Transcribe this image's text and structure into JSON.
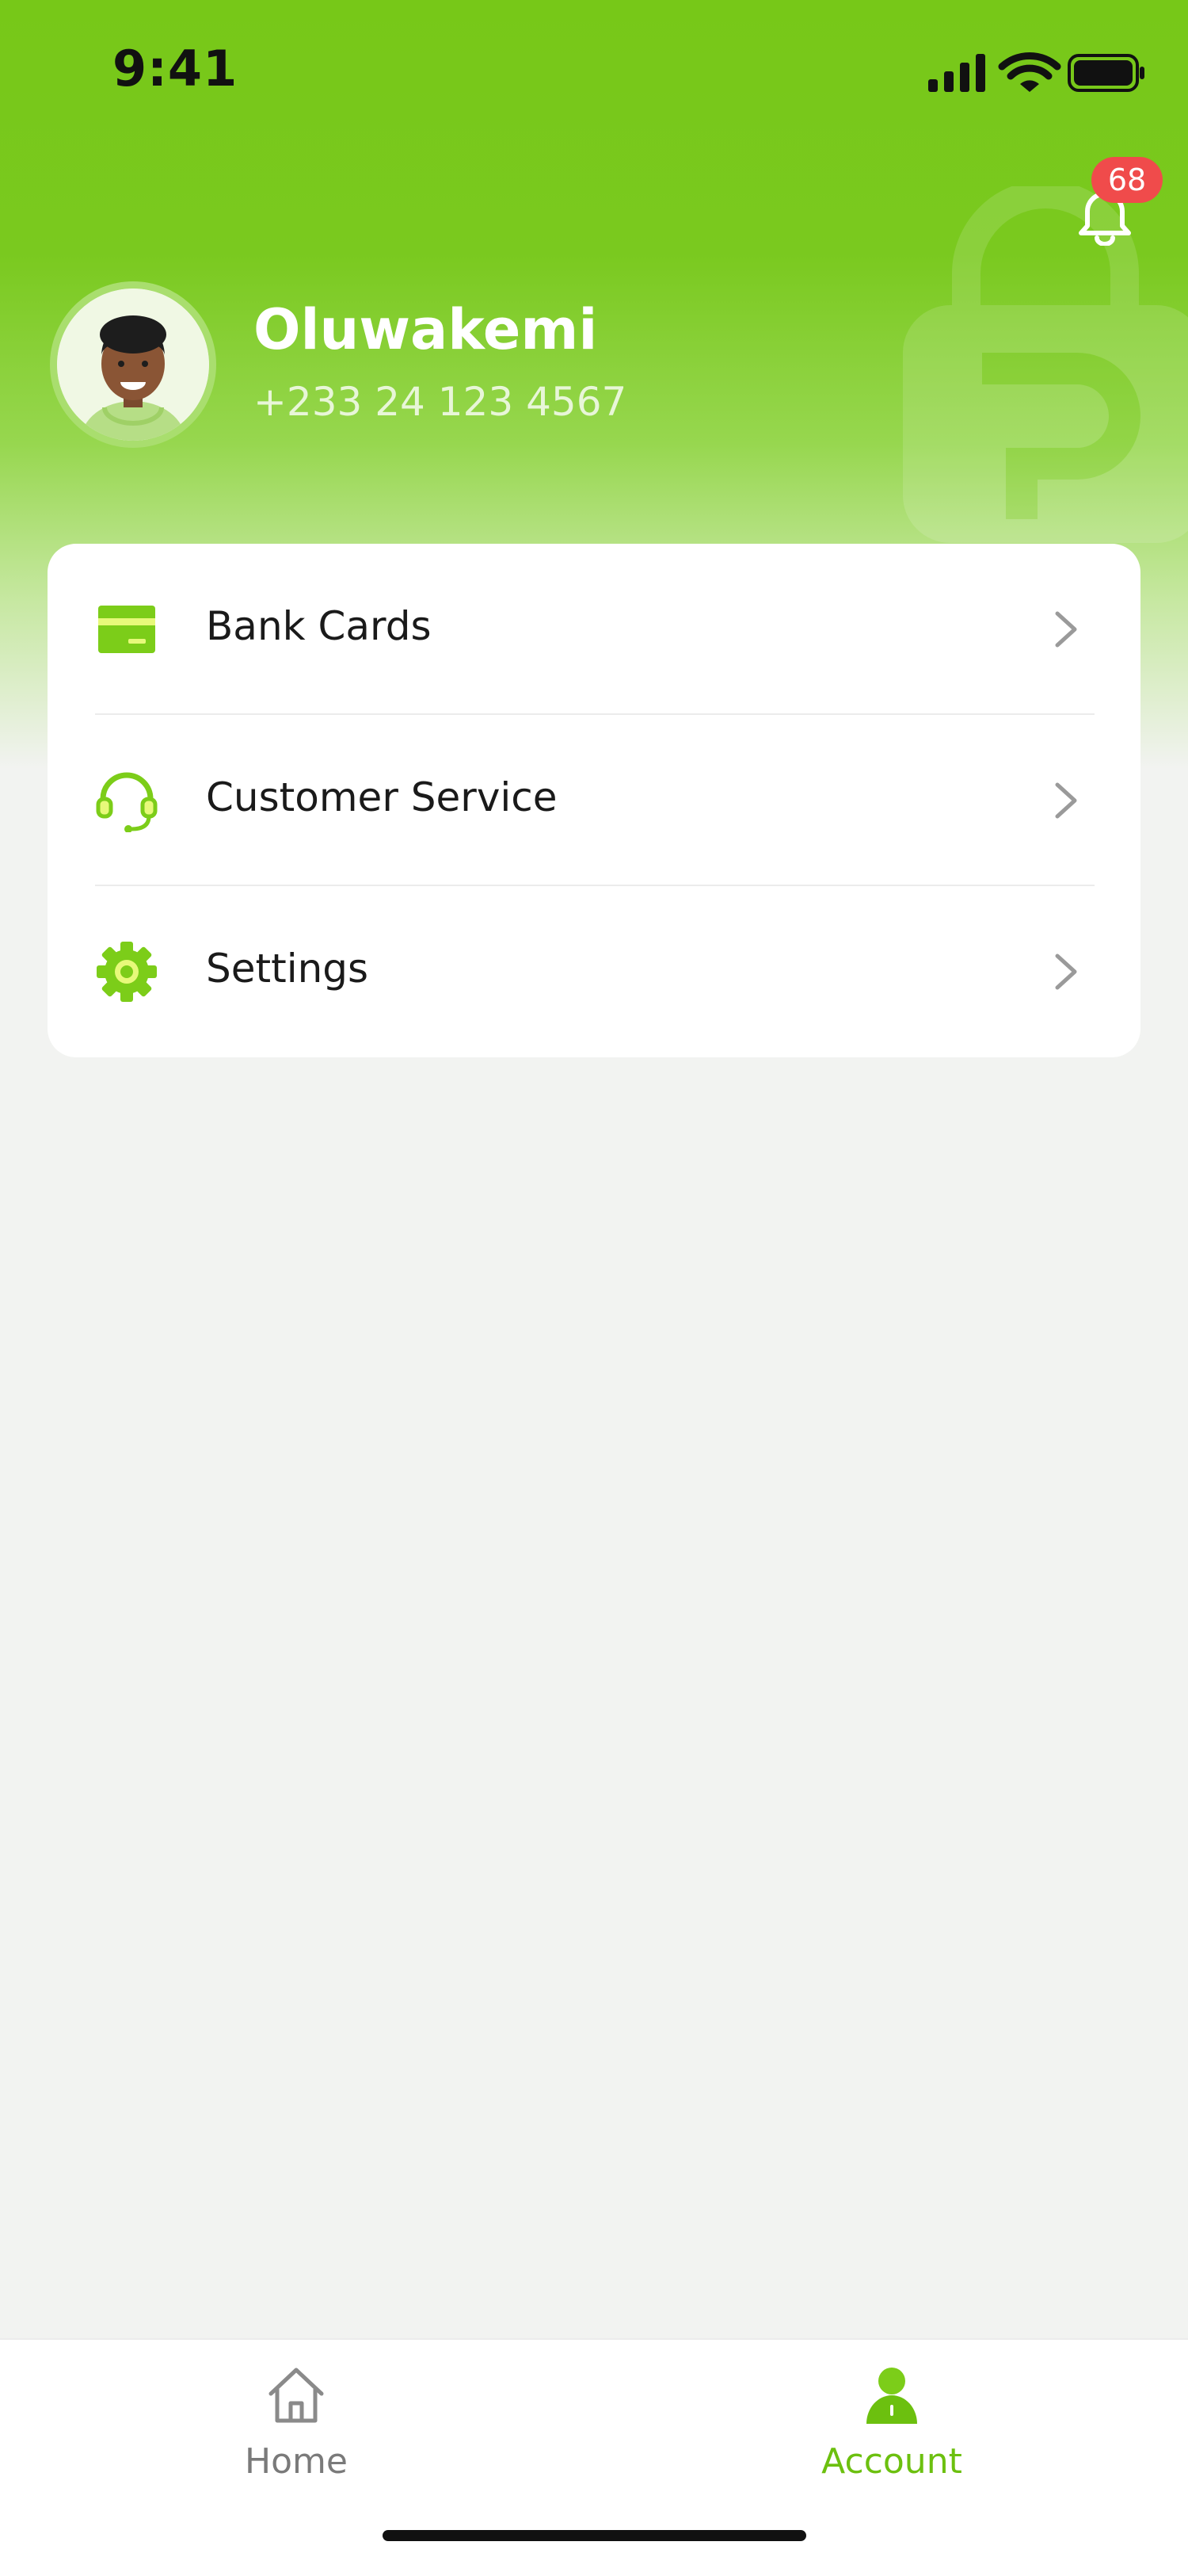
{
  "status_bar": {
    "time": "9:41"
  },
  "notifications": {
    "count": "68",
    "icon": "bell-icon"
  },
  "profile": {
    "name": "Oluwakemi",
    "phone": "+233 24 123 4567"
  },
  "menu": {
    "items": [
      {
        "label": "Bank Cards",
        "icon": "bank-card-icon"
      },
      {
        "label": "Customer Service",
        "icon": "headset-icon"
      },
      {
        "label": "Settings",
        "icon": "gear-icon"
      }
    ]
  },
  "tab_bar": {
    "tabs": [
      {
        "label": "Home",
        "icon": "home-icon",
        "active": false
      },
      {
        "label": "Account",
        "icon": "account-icon",
        "active": true
      }
    ]
  },
  "colors": {
    "brand_green": "#77c818",
    "active_tab": "#6cc00f",
    "inactive_tab": "#7a7a7a",
    "badge_red": "#f04b4b"
  }
}
